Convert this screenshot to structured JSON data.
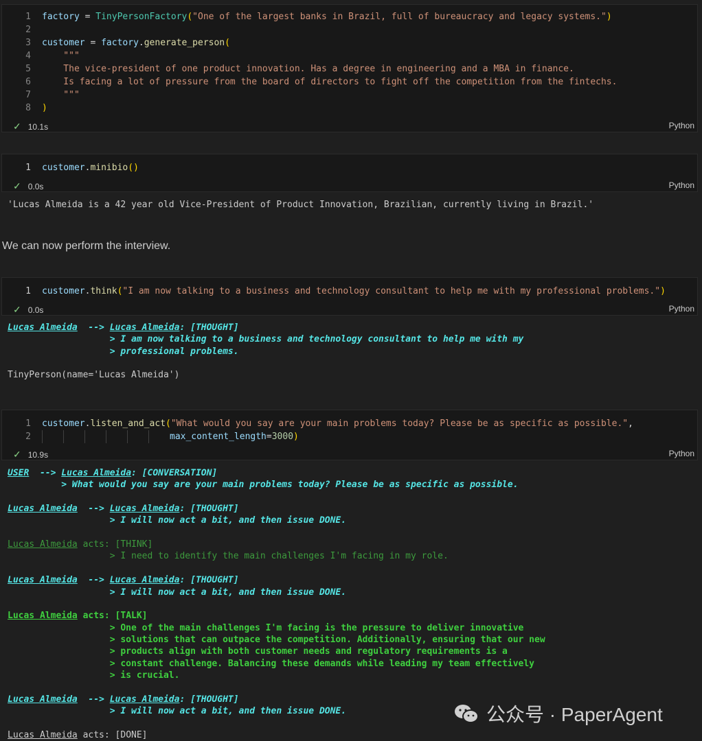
{
  "cells": {
    "c1": {
      "lines": [
        {
          "n": "1",
          "parts": [
            [
              "v",
              "factory"
            ],
            [
              "o",
              " = "
            ],
            [
              "c",
              "TinyPersonFactory"
            ],
            [
              "p",
              "("
            ],
            [
              "s",
              "\"One of the largest banks in Brazil, full of bureaucracy and legacy systems.\""
            ],
            [
              "p",
              ")"
            ]
          ]
        },
        {
          "n": "2",
          "parts": []
        },
        {
          "n": "3",
          "parts": [
            [
              "v",
              "customer"
            ],
            [
              "o",
              " = "
            ],
            [
              "v",
              "factory"
            ],
            [
              "o",
              "."
            ],
            [
              "f",
              "generate_person"
            ],
            [
              "p",
              "("
            ]
          ]
        },
        {
          "n": "4",
          "parts": [
            [
              "s",
              "    \"\"\""
            ]
          ]
        },
        {
          "n": "5",
          "parts": [
            [
              "s",
              "    The vice-president of one product innovation. Has a degree in engineering and a MBA in finance."
            ]
          ]
        },
        {
          "n": "6",
          "parts": [
            [
              "s",
              "    Is facing a lot of pressure from the board of directors to fight off the competition from the fintechs."
            ]
          ]
        },
        {
          "n": "7",
          "parts": [
            [
              "s",
              "    \"\"\""
            ]
          ]
        },
        {
          "n": "8",
          "parts": [
            [
              "p",
              ")"
            ]
          ]
        }
      ],
      "time": "10.1s",
      "lang": "Python"
    },
    "c2": {
      "lines": [
        {
          "n": "1",
          "parts": [
            [
              "v",
              "customer"
            ],
            [
              "o",
              "."
            ],
            [
              "f",
              "minibio"
            ],
            [
              "p",
              "()"
            ]
          ]
        }
      ],
      "time": "0.0s",
      "lang": "Python",
      "output": "'Lucas Almeida is a 42 year old Vice-President of Product Innovation, Brazilian, currently living in Brazil.'"
    },
    "c3": {
      "lines": [
        {
          "n": "1",
          "parts": [
            [
              "v",
              "customer"
            ],
            [
              "o",
              "."
            ],
            [
              "f",
              "think"
            ],
            [
              "p",
              "("
            ],
            [
              "s",
              "\"I am now talking to a business and technology consultant to help me with my professional problems.\""
            ],
            [
              "p",
              ")"
            ]
          ]
        }
      ],
      "time": "0.0s",
      "lang": "Python"
    },
    "c4": {
      "lines": [
        {
          "n": "1",
          "parts": [
            [
              "v",
              "customer"
            ],
            [
              "o",
              "."
            ],
            [
              "f",
              "listen_and_act"
            ],
            [
              "p",
              "("
            ],
            [
              "s",
              "\"What would you say are your main problems today? Please be as specific as possible.\""
            ],
            [
              "o",
              ","
            ]
          ]
        },
        {
          "n": "2",
          "parts": [
            [
              "guides",
              "6"
            ],
            [
              "v",
              "max_content_length"
            ],
            [
              "o",
              "="
            ],
            [
              "n",
              "3000"
            ],
            [
              "p",
              ")"
            ]
          ]
        }
      ],
      "time": "10.9s",
      "lang": "Python"
    }
  },
  "markdown": "We can now perform the interview.",
  "out3": [
    {
      "cls": "cyanb",
      "segs": [
        [
          "und",
          "Lucas Almeida"
        ],
        [
          "",
          "  --> "
        ],
        [
          "und",
          "Lucas Almeida"
        ],
        [
          "",
          ": [THOUGHT]"
        ]
      ]
    },
    {
      "cls": "cyanb",
      "segs": [
        [
          "",
          "                   > I am now talking to a business and technology consultant to help me with my"
        ]
      ]
    },
    {
      "cls": "cyanb",
      "segs": [
        [
          "",
          "                   > professional problems."
        ]
      ]
    },
    {
      "cls": "",
      "segs": [
        [
          "",
          ""
        ]
      ]
    },
    {
      "cls": "",
      "segs": [
        [
          "",
          "TinyPerson(name='Lucas Almeida')"
        ]
      ]
    }
  ],
  "out4": [
    {
      "cls": "cyanb",
      "segs": [
        [
          "und",
          "USER"
        ],
        [
          "",
          "  --> "
        ],
        [
          "und",
          "Lucas Almeida"
        ],
        [
          "",
          ": [CONVERSATION]"
        ]
      ]
    },
    {
      "cls": "cyanb",
      "segs": [
        [
          "",
          "          > What would you say are your main problems today? Please be as specific as possible."
        ]
      ]
    },
    {
      "cls": "",
      "segs": [
        [
          "",
          ""
        ]
      ]
    },
    {
      "cls": "cyanb",
      "segs": [
        [
          "und",
          "Lucas Almeida"
        ],
        [
          "",
          "  --> "
        ],
        [
          "und",
          "Lucas Almeida"
        ],
        [
          "",
          ": [THOUGHT]"
        ]
      ]
    },
    {
      "cls": "cyanb",
      "segs": [
        [
          "",
          "                   > I will now act a bit, and then issue DONE."
        ]
      ]
    },
    {
      "cls": "",
      "segs": [
        [
          "",
          ""
        ]
      ]
    },
    {
      "cls": "grn",
      "segs": [
        [
          "und",
          "Lucas Almeida"
        ],
        [
          "",
          " acts: [THINK]"
        ]
      ]
    },
    {
      "cls": "grn",
      "segs": [
        [
          "",
          "                   > I need to identify the main challenges I'm facing in my role."
        ]
      ]
    },
    {
      "cls": "",
      "segs": [
        [
          "",
          ""
        ]
      ]
    },
    {
      "cls": "cyanb",
      "segs": [
        [
          "und",
          "Lucas Almeida"
        ],
        [
          "",
          "  --> "
        ],
        [
          "und",
          "Lucas Almeida"
        ],
        [
          "",
          ": [THOUGHT]"
        ]
      ]
    },
    {
      "cls": "cyanb",
      "segs": [
        [
          "",
          "                   > I will now act a bit, and then issue DONE."
        ]
      ]
    },
    {
      "cls": "",
      "segs": [
        [
          "",
          ""
        ]
      ]
    },
    {
      "cls": "grnb",
      "segs": [
        [
          "und",
          "Lucas Almeida"
        ],
        [
          "",
          " acts: [TALK]"
        ]
      ]
    },
    {
      "cls": "grnb",
      "segs": [
        [
          "",
          "                   > One of the main challenges I'm facing is the pressure to deliver innovative"
        ]
      ]
    },
    {
      "cls": "grnb",
      "segs": [
        [
          "",
          "                   > solutions that can outpace the competition. Additionally, ensuring that our new"
        ]
      ]
    },
    {
      "cls": "grnb",
      "segs": [
        [
          "",
          "                   > products align with both customer needs and regulatory requirements is a"
        ]
      ]
    },
    {
      "cls": "grnb",
      "segs": [
        [
          "",
          "                   > constant challenge. Balancing these demands while leading my team effectively"
        ]
      ]
    },
    {
      "cls": "grnb",
      "segs": [
        [
          "",
          "                   > is crucial."
        ]
      ]
    },
    {
      "cls": "",
      "segs": [
        [
          "",
          ""
        ]
      ]
    },
    {
      "cls": "cyanb",
      "segs": [
        [
          "und",
          "Lucas Almeida"
        ],
        [
          "",
          "  --> "
        ],
        [
          "und",
          "Lucas Almeida"
        ],
        [
          "",
          ": [THOUGHT]"
        ]
      ]
    },
    {
      "cls": "cyanb",
      "segs": [
        [
          "",
          "                   > I will now act a bit, and then issue DONE."
        ]
      ]
    },
    {
      "cls": "",
      "segs": [
        [
          "",
          ""
        ]
      ]
    },
    {
      "cls": "plain",
      "segs": [
        [
          "und",
          "Lucas Almeida"
        ],
        [
          "",
          " acts: [DONE]"
        ]
      ]
    }
  ],
  "watermark": "公众号 · PaperAgent"
}
